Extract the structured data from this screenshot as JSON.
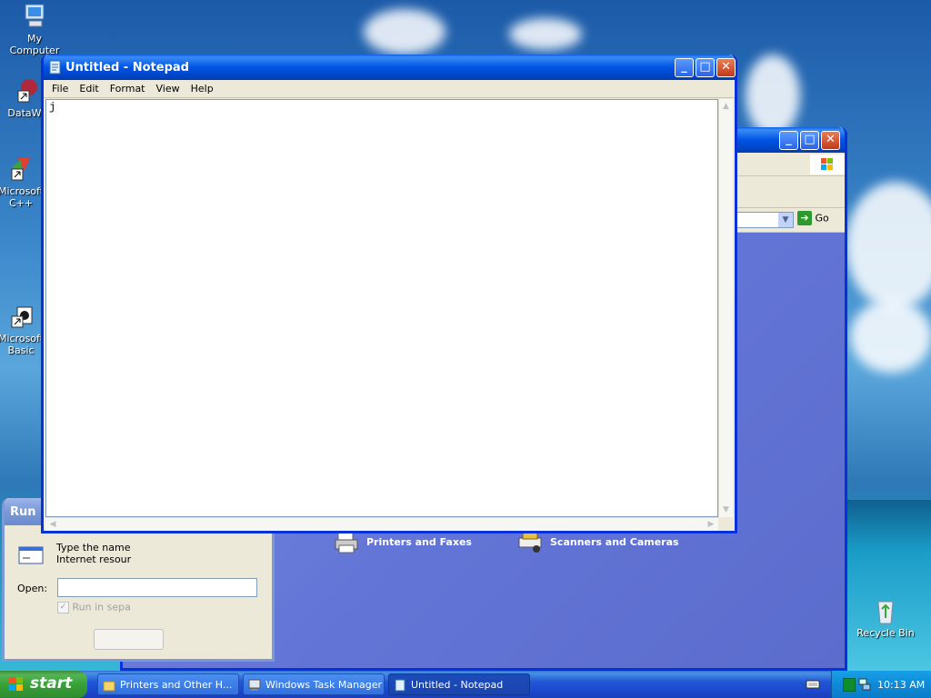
{
  "desktop": {
    "icons": [
      {
        "label": "My Computer",
        "icon": "my-computer-icon"
      },
      {
        "label": "DataWa",
        "icon": "shortcut-icon"
      },
      {
        "label": "Microsoft\nC++",
        "icon": "shortcut-icon"
      },
      {
        "label": "Microsoft\nBasic",
        "icon": "shortcut-icon"
      },
      {
        "label": "Recycle Bin",
        "icon": "recycle-bin-icon"
      }
    ]
  },
  "notepad": {
    "title": "Untitled - Notepad",
    "menu": [
      "File",
      "Edit",
      "Format",
      "View",
      "Help"
    ],
    "content": "j"
  },
  "explorer": {
    "go_label": "Go",
    "items": [
      {
        "label": "Printers and Faxes",
        "icon": "printer-icon"
      },
      {
        "label": "Scanners and Cameras",
        "icon": "scanner-icon"
      }
    ]
  },
  "run_dialog": {
    "title": "Run",
    "description": "Type the name\nInternet resour",
    "open_label": "Open:",
    "checkbox_label": "Run in sepa"
  },
  "taskbar": {
    "start_label": "start",
    "tasks": [
      {
        "label": "Printers and Other H...",
        "active": false
      },
      {
        "label": "Windows Task Manager",
        "active": false
      },
      {
        "label": "Untitled - Notepad",
        "active": true
      }
    ],
    "clock": "10:13 AM"
  },
  "colors": {
    "titlebar": "#0054e3",
    "taskbar": "#2157d7",
    "start": "#38a238",
    "explorer_bg": "#6375d6"
  }
}
